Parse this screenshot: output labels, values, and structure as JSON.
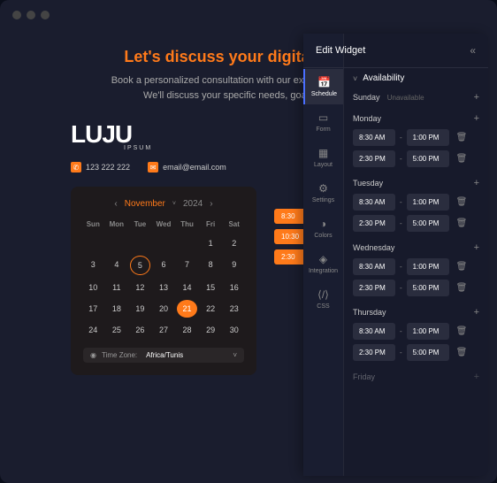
{
  "headline": "Let's discuss your digital transfo",
  "desc1": "Book a personalized consultation with our experts to explore sol",
  "desc2": "We'll discuss your specific needs, goals, and cha",
  "logo": "LUJU",
  "logo_sub": "IPSUM",
  "phone": "123 222 222",
  "email": "email@email.com",
  "cal": {
    "month": "November",
    "year": "2024",
    "dow": [
      "Sun",
      "Mon",
      "Tue",
      "Wed",
      "Thu",
      "Fri",
      "Sat"
    ],
    "tz_label": "Time Zone:",
    "tz_value": "Africa/Tunis"
  },
  "pills": [
    "8:30",
    "10:30",
    "2:30"
  ],
  "panel": {
    "title": "Edit Widget",
    "tabs": [
      {
        "id": "schedule",
        "label": "Schedule",
        "active": true
      },
      {
        "id": "form",
        "label": "Form"
      },
      {
        "id": "layout",
        "label": "Layout"
      },
      {
        "id": "settings",
        "label": "Settings"
      },
      {
        "id": "colors",
        "label": "Colors"
      },
      {
        "id": "integration",
        "label": "Integration"
      },
      {
        "id": "css",
        "label": "CSS"
      }
    ],
    "section": "Availability",
    "days": [
      {
        "name": "Sunday",
        "unavailable": true,
        "label": "Unavailable"
      },
      {
        "name": "Monday",
        "slots": [
          [
            "8:30 AM",
            "1:00 PM"
          ],
          [
            "2:30 PM",
            "5:00 PM"
          ]
        ]
      },
      {
        "name": "Tuesday",
        "slots": [
          [
            "8:30 AM",
            "1:00 PM"
          ],
          [
            "2:30 PM",
            "5:00 PM"
          ]
        ]
      },
      {
        "name": "Wednesday",
        "slots": [
          [
            "8:30 AM",
            "1:00 PM"
          ],
          [
            "2:30 PM",
            "5:00 PM"
          ]
        ]
      },
      {
        "name": "Thursday",
        "slots": [
          [
            "8:30 AM",
            "1:00 PM"
          ],
          [
            "2:30 PM",
            "5:00 PM"
          ]
        ]
      },
      {
        "name": "Friday",
        "faded": true,
        "slots": []
      }
    ]
  }
}
